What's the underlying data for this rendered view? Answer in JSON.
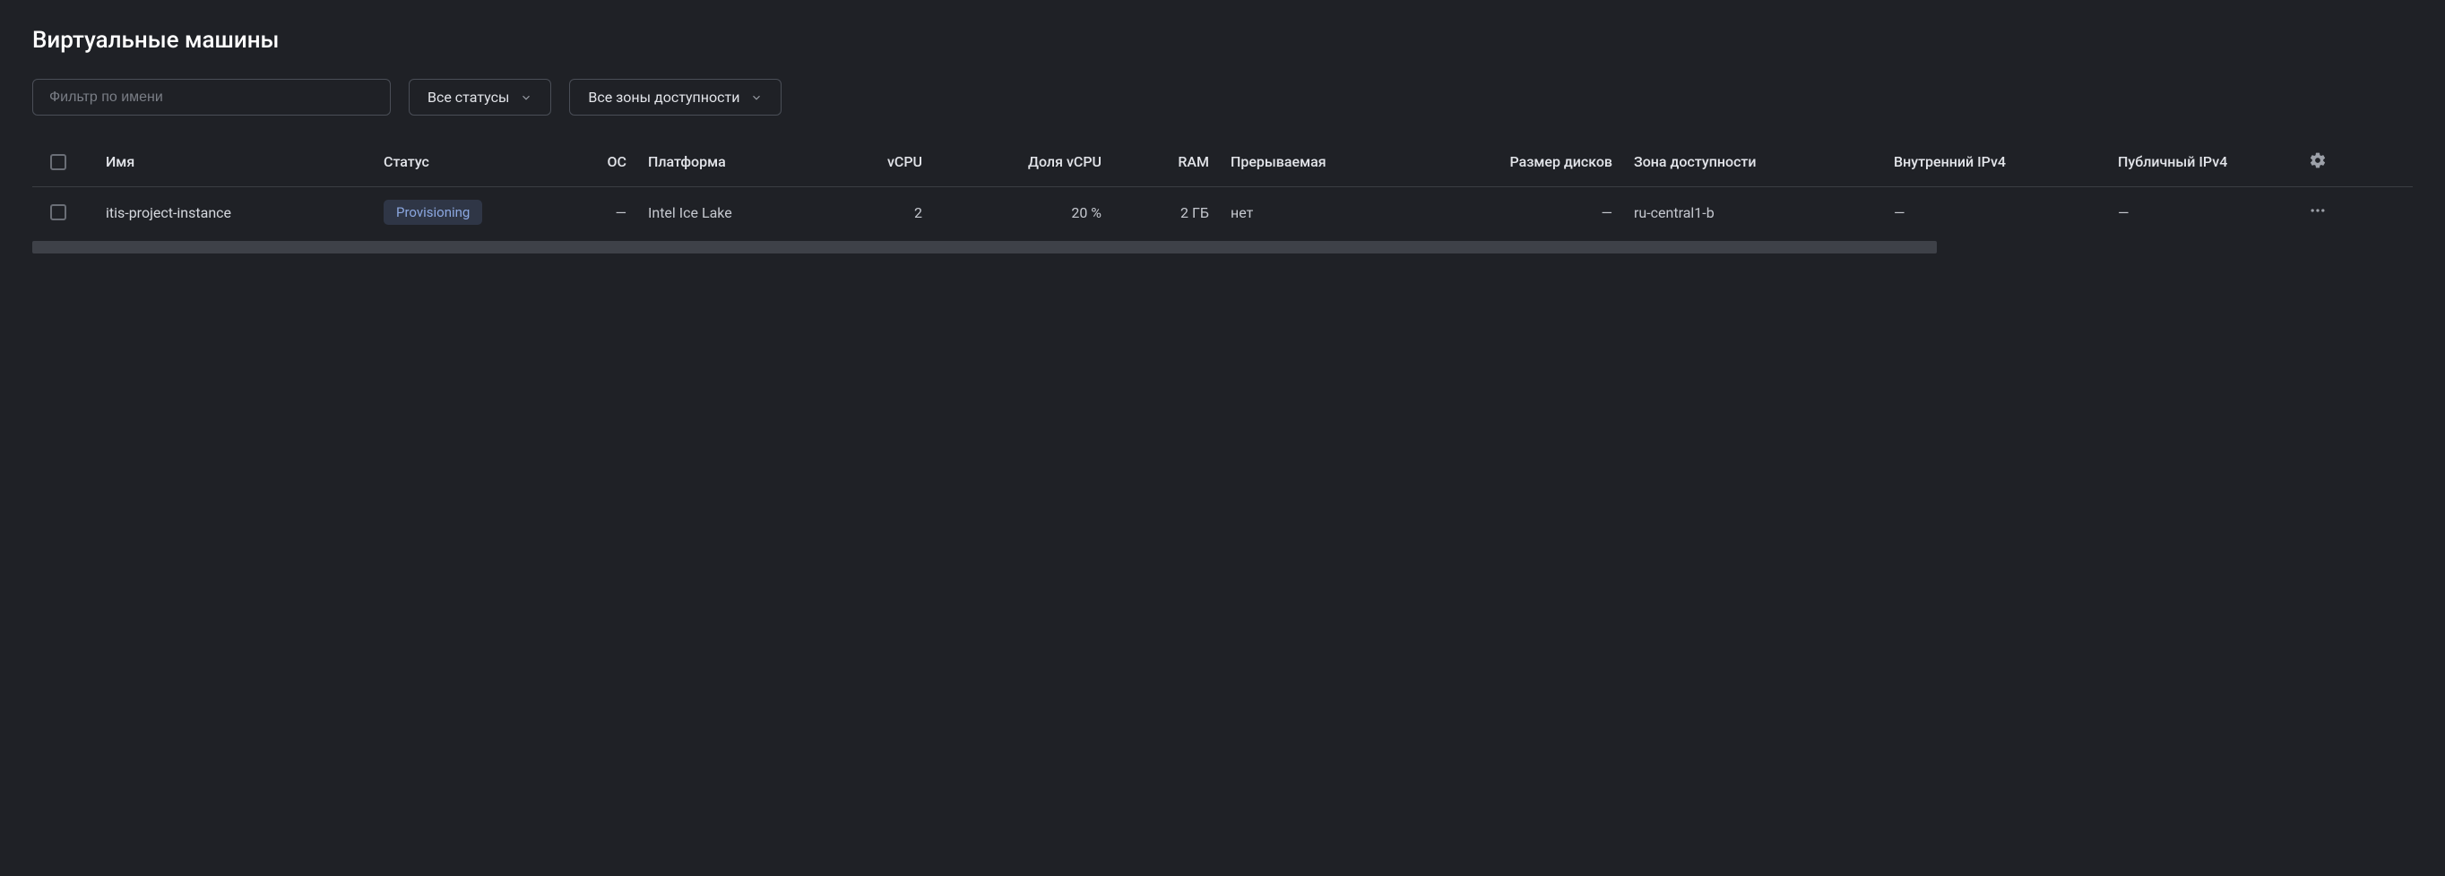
{
  "page_title": "Виртуальные машины",
  "filters": {
    "name_placeholder": "Фильтр по имени",
    "status_label": "Все статусы",
    "zone_label": "Все зоны доступности"
  },
  "columns": {
    "name": "Имя",
    "status": "Статус",
    "os": "ОС",
    "platform": "Платформа",
    "vcpu": "vCPU",
    "vcpu_share": "Доля vCPU",
    "ram": "RAM",
    "preemptible": "Прерываемая",
    "disk_size": "Размер дисков",
    "zone": "Зона доступности",
    "internal_ip": "Внутренний IPv4",
    "public_ip": "Публичный IPv4"
  },
  "rows": [
    {
      "name": "itis-project-instance",
      "status": "Provisioning",
      "os": "—",
      "platform": "Intel Ice Lake",
      "vcpu": "2",
      "vcpu_share": "20 %",
      "ram": "2 ГБ",
      "preemptible": "нет",
      "disk_size": "—",
      "zone": "ru-central1-b",
      "internal_ip": "—",
      "public_ip": "—"
    }
  ]
}
